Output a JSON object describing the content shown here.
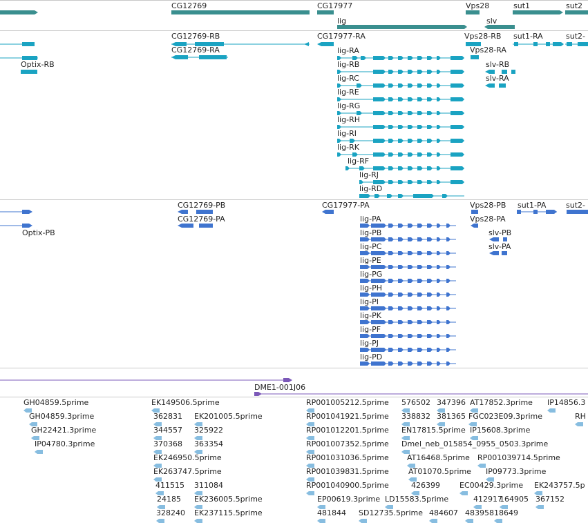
{
  "colors": {
    "gene": "#3a8f8f",
    "transcript": "#1aa3c2",
    "protein": "#3f74cf",
    "clone": "#7b58b8",
    "est": "#87bde0",
    "divider": "#c8c8c8"
  },
  "gene_track": {
    "labels": [
      "CG12769",
      "CG17977",
      "lig",
      "Vps28",
      "slv",
      "sut1",
      "sut2"
    ]
  },
  "transcript_track": {
    "labels": [
      "CG12769-RB",
      "CG12769-RA",
      "CG17977-RA",
      "Vps28-RB",
      "sut1-RA",
      "sut2-",
      "Vps28-RA",
      "Optix-RB",
      "lig-RA",
      "lig-RB",
      "slv-RB",
      "lig-RC",
      "slv-RA",
      "lig-RE",
      "lig-RG",
      "lig-RH",
      "lig-RI",
      "lig-RK",
      "lig-RF",
      "lig-RJ",
      "lig-RD"
    ]
  },
  "protein_track": {
    "labels": [
      "CG12769-PB",
      "CG12769-PA",
      "CG17977-PA",
      "Vps28-PB",
      "sut1-PA",
      "sut2-",
      "Vps28-PA",
      "Optix-PB",
      "lig-PA",
      "lig-PB",
      "slv-PB",
      "lig-PC",
      "slv-PA",
      "lig-PE",
      "lig-PG",
      "lig-PH",
      "lig-PI",
      "lig-PK",
      "lig-PF",
      "lig-PJ",
      "lig-PD"
    ]
  },
  "clone_track": {
    "labels": [
      "DME1-001J06"
    ]
  },
  "est_track": {
    "labels": [
      "GH04859.5prime",
      "EK149506.5prime",
      "RP001005212.5prime",
      "576502",
      "347396",
      "AT17852.3prime",
      "IP14856.3",
      "GH04859.3prime",
      "362831",
      "EK201005.5prime",
      "RP001041921.5prime",
      "338832",
      "381365",
      "FGC023E09.3prime",
      "RH",
      "GH22421.3prime",
      "344557",
      "325922",
      "RP001012201.5prime",
      "EN17815.5prime",
      "IP15608.3prime",
      "IP04780.3prime",
      "370368",
      "363354",
      "RP001007352.5prime",
      "Dmel_neb_015854_0955_0503.3prime",
      "EK246950.5prime",
      "RP001031036.5prime",
      "AT16468.5prime",
      "RP001039714.5prime",
      "EK263747.5prime",
      "RP001039831.5prime",
      "AT01070.5prime",
      "IP09773.3prime",
      "411515",
      "311084",
      "RP001040900.5prime",
      "426399",
      "EC00429.3prime",
      "EK243757.5p",
      "24185",
      "EK236005.5prime",
      "EP00619.3prime",
      "LD15583.5prime",
      "412917",
      "164905",
      "367152",
      "328240",
      "EK237115.5prime",
      "481844",
      "SD12735.5prime",
      "484607",
      "483958",
      "18649"
    ]
  }
}
